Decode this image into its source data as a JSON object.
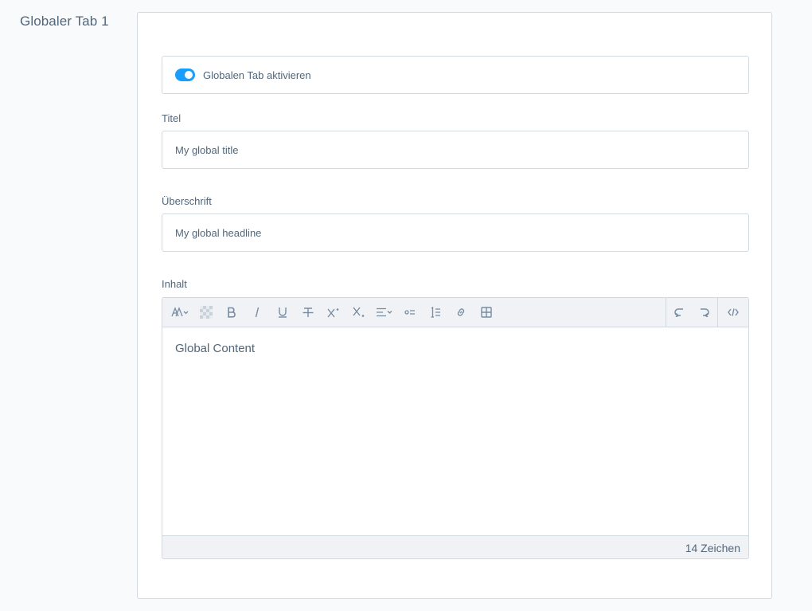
{
  "section": {
    "title": "Globaler Tab 1"
  },
  "toggle": {
    "label": "Globalen Tab aktivieren",
    "checked": true
  },
  "fields": {
    "title": {
      "label": "Titel",
      "value": "My global title"
    },
    "headline": {
      "label": "Überschrift",
      "value": "My global headline"
    },
    "content": {
      "label": "Inhalt",
      "value": "Global Content"
    }
  },
  "editor": {
    "toolbar": [
      "text-style-icon",
      "text-color-icon",
      "bold-icon",
      "italic-icon",
      "underline-icon",
      "strikethrough-icon",
      "superscript-icon",
      "subscript-icon",
      "align-icon",
      "unordered-list-icon",
      "ordered-list-icon",
      "link-icon",
      "table-icon",
      "undo-icon",
      "redo-icon",
      "code-view-icon"
    ],
    "char_count": "14 Zeichen"
  },
  "colors": {
    "accent": "#189eff",
    "text": "#52667a",
    "border": "#d1d9e0",
    "toolbar_bg": "#f0f2f5",
    "page_bg": "#f9fafc"
  }
}
